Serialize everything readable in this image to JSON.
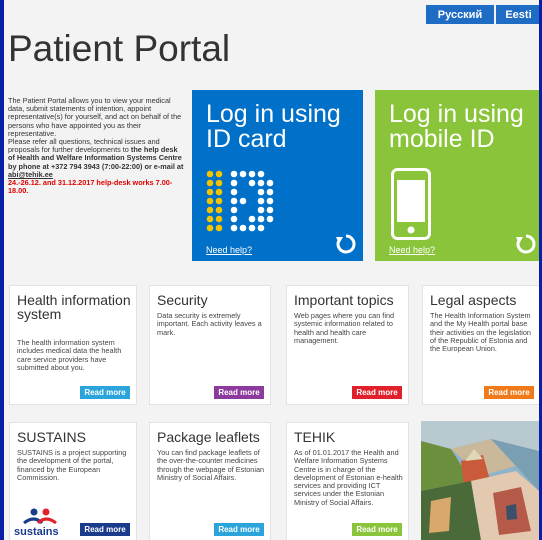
{
  "languages": [
    "Русский",
    "Eesti"
  ],
  "page_title": "Patient Portal",
  "intro": {
    "text": "The Patient Portal allows you to view your medical data, submit statements of intention, appoint representative(s) for yourself, and act on behalf of the persons who have appointed you as their representative.",
    "contact_prefix": "Please refer all questions, technical issues and proposals for further developments to",
    "contact_bold": "the help desk of Health and Welfare Information Systems Centre by phone at +372 794 3943 (7:00-22:00) or e-mail at",
    "email": "abi@tehik.ee",
    "notice": "24.-26.12. and 31.12.2017 help-desk works 7.00-18.00."
  },
  "login_tiles": [
    {
      "label": "Log in using ID card",
      "help": "Need help?",
      "color": "#0070c8"
    },
    {
      "label": "Log in using mobile ID",
      "help": "Need help?",
      "color": "#8ac43a"
    }
  ],
  "cards": [
    {
      "title": "Health information system",
      "body": "The health information system includes medical data the health care service providers have submitted about you.",
      "button": "Read more",
      "button_color": "#2aa4da"
    },
    {
      "title": "Security",
      "body": "Data security is extremely important. Each activity leaves a mark.",
      "button": "Read more",
      "button_color": "#8c3a9e"
    },
    {
      "title": "Important topics",
      "body": "Web pages where you can find systemic information related to health and health care management.",
      "button": "Read more",
      "button_color": "#e0202a"
    },
    {
      "title": "Legal aspects",
      "body": "The Health Information System and the My Health portal base their activities on the legislation of the Republic of Estonia and the European Union.",
      "button": "Read more",
      "button_color": "#f07a1a"
    },
    {
      "title": "SUSTAINS",
      "body": "SUSTAINS is a project supporting the development of the portal, financed by the European Commission.",
      "button": "Read more",
      "button_color": "#1a3a8c",
      "logo": "sustains"
    },
    {
      "title": "Package leaflets",
      "body": "You can find package leaflets of the over-the-counter medicines through the webpage of Estonian Ministry of Social Affairs.",
      "button": "Read more",
      "button_color": "#2aa4da"
    },
    {
      "title": "TEHIK",
      "body": "As of 01.01.2017 the Health and Welfare Information Systems Centre is in charge of the development of Estonian e-health services and providing ICT services under the Estonian Ministry of Social Affairs.",
      "button": "Read more",
      "button_color": "#8ac43a"
    }
  ]
}
